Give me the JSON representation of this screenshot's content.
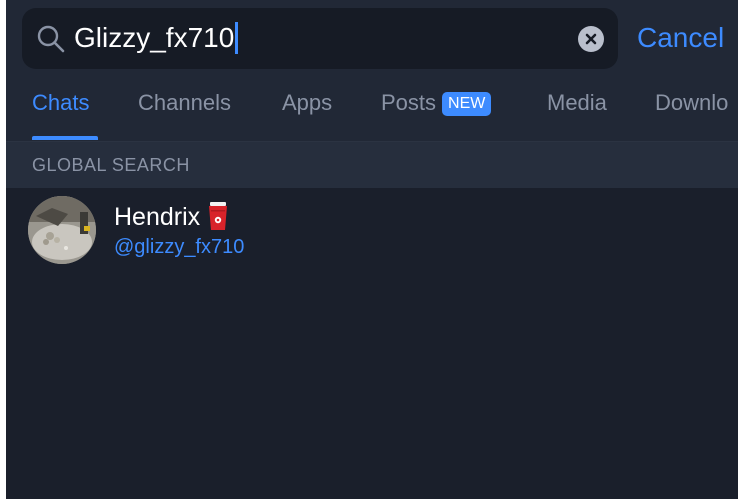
{
  "search": {
    "query": "Glizzy_fx710",
    "cancel_label": "Cancel"
  },
  "tabs": [
    {
      "label": "Chats",
      "active": true
    },
    {
      "label": "Channels",
      "active": false
    },
    {
      "label": "Apps",
      "active": false
    },
    {
      "label": "Posts",
      "active": false,
      "badge": "NEW"
    },
    {
      "label": "Media",
      "active": false
    },
    {
      "label": "Downlo",
      "active": false
    }
  ],
  "section": {
    "title": "GLOBAL SEARCH"
  },
  "results": [
    {
      "name": "Hendrix",
      "emoji_icon": "red-cup-icon",
      "username": "@glizzy_fx710"
    }
  ],
  "colors": {
    "background": "#1a1f2b",
    "header": "#212836",
    "accent": "#3d8bff",
    "muted_text": "#8a93a5"
  }
}
